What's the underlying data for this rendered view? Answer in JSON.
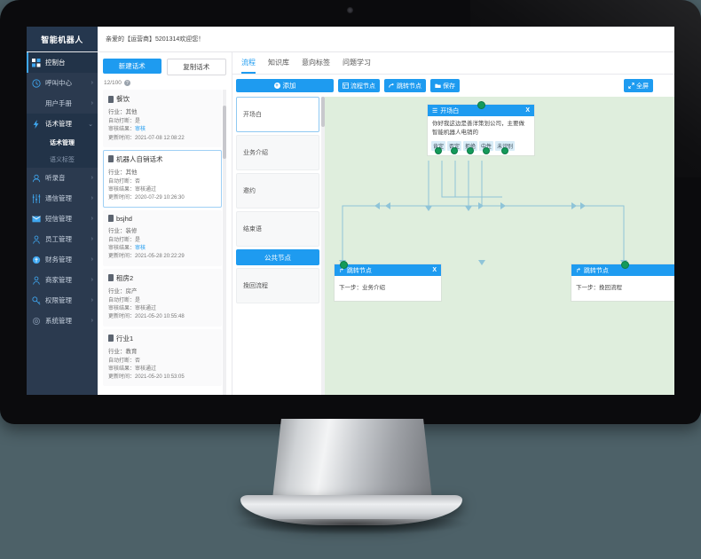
{
  "app": {
    "brand": "智能机器人",
    "welcome": "亲爱的【运营商】5201314欢迎您！"
  },
  "sidebar": {
    "items": [
      {
        "label": "控制台",
        "icon": "dashboard-icon",
        "state": "active",
        "arrow": ""
      },
      {
        "label": "呼叫中心",
        "icon": "clock-icon",
        "state": "",
        "arrow": "›"
      },
      {
        "label": "用户手册",
        "icon": "",
        "state": "",
        "arrow": "›"
      },
      {
        "label": "话术管理",
        "icon": "bolt-icon",
        "state": "open",
        "arrow": "⌄"
      },
      {
        "label": "听录音",
        "icon": "headset-icon",
        "state": "",
        "arrow": "›"
      },
      {
        "label": "通信管理",
        "icon": "sliders-icon",
        "state": "",
        "arrow": "›"
      },
      {
        "label": "短信管理",
        "icon": "mail-icon",
        "state": "",
        "arrow": "›"
      },
      {
        "label": "员工管理",
        "icon": "user-icon",
        "state": "",
        "arrow": "›"
      },
      {
        "label": "财务管理",
        "icon": "coin-icon",
        "state": "",
        "arrow": "›"
      },
      {
        "label": "商家管理",
        "icon": "user-icon",
        "state": "",
        "arrow": "›"
      },
      {
        "label": "权限管理",
        "icon": "key-icon",
        "state": "",
        "arrow": "›"
      },
      {
        "label": "系统管理",
        "icon": "gear-icon",
        "state": "",
        "arrow": "›"
      }
    ],
    "submenu": [
      {
        "label": "话术管理",
        "active": true
      },
      {
        "label": "语义标签",
        "active": false
      }
    ]
  },
  "list_panel": {
    "new_button": "新建话术",
    "copy_button": "复制话术",
    "counter": "12/100",
    "help_icon": "?",
    "labels": {
      "industry": "行业",
      "auto_interrupt": "自动打断",
      "review_result": "审核结果",
      "update_time": "更新时间"
    },
    "items": [
      {
        "title": "餐饮",
        "industry": "行业：其他",
        "auto": "自动打断：是",
        "review": "审核结果：",
        "review_value": "审核",
        "review_link": true,
        "time": "更新时间：2021-07-08 12:08:22",
        "selected": false
      },
      {
        "title": "机器人自销话术",
        "industry": "行业：其他",
        "auto": "自动打断：否",
        "review": "审核结果：",
        "review_value": "审核通过",
        "review_link": false,
        "time": "更新时间：2020-07-29 10:26:30",
        "selected": true
      },
      {
        "title": "bsjhd",
        "industry": "行业：装修",
        "auto": "自动打断：是",
        "review": "审核结果：",
        "review_value": "审核",
        "review_link": true,
        "time": "更新时间：2021-05-28 20:22:29",
        "selected": false
      },
      {
        "title": "租房2",
        "industry": "行业：房产",
        "auto": "自动打断：是",
        "review": "审核结果：",
        "review_value": "审核通过",
        "review_link": false,
        "time": "更新时间：2021-05-20 10:55:48",
        "selected": false
      },
      {
        "title": "行业1",
        "industry": "行业：教育",
        "auto": "自动打断：否",
        "review": "审核结果：",
        "review_value": "审核通过",
        "review_link": false,
        "time": "更新时间：2021-05-20 10:53:05",
        "selected": false
      }
    ]
  },
  "content": {
    "tabs": [
      {
        "label": "流程",
        "active": true
      },
      {
        "label": "知识库",
        "active": false
      },
      {
        "label": "意向标签",
        "active": false
      },
      {
        "label": "问题学习",
        "active": false
      }
    ],
    "toolbar": {
      "add": "添加",
      "flow_node": "流程节点",
      "jump_node": "跳转节点",
      "save": "保存",
      "fullscreen": "全屏"
    },
    "node_list": [
      {
        "label": "开场白",
        "type": "cell",
        "selected": true
      },
      {
        "label": "业务介绍",
        "type": "cell",
        "selected": false
      },
      {
        "label": "邀约",
        "type": "cell",
        "selected": false
      },
      {
        "label": "结束语",
        "type": "cell",
        "selected": false
      },
      {
        "label": "公共节点",
        "type": "header",
        "selected": false
      },
      {
        "label": "挽回流程",
        "type": "cell",
        "selected": false
      }
    ]
  },
  "flow": {
    "main_node": {
      "title": "开场白",
      "close": "X",
      "text": "你好我这边是善洋策划公司，主要做智能机器人电销的",
      "branches": [
        "肯定",
        "否定",
        "拒绝",
        "中性",
        "未识别"
      ]
    },
    "jump_nodes": [
      {
        "title": "跳转节点",
        "close": "X",
        "text": "下一步：业务介绍"
      },
      {
        "title": "跳转节点",
        "close": "",
        "text": "下一步：挽回流程"
      }
    ]
  },
  "colors": {
    "accent": "#1e9bf0",
    "sidebar": "#2b3a4f",
    "canvas": "#dfeedd",
    "port": "#149a5a"
  }
}
